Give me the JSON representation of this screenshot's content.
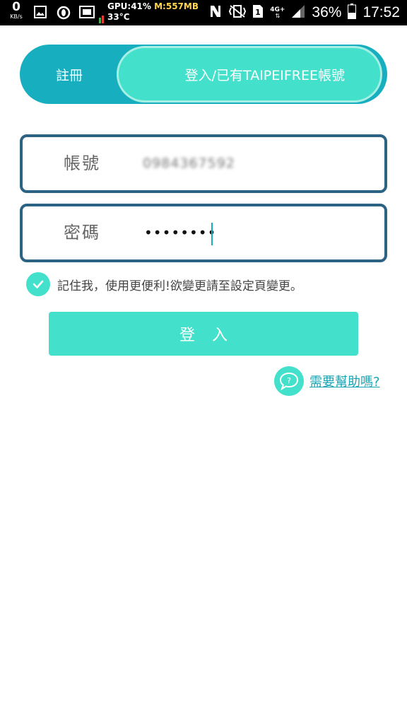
{
  "status_bar": {
    "net_speed": "0",
    "net_unit": "KB/s",
    "gpu": "GPU:41%",
    "memory": "M:557MB",
    "temperature": "33°C",
    "battery": "36%",
    "time": "17:52",
    "network_type": "4G+",
    "sim_slot": "1",
    "icons": [
      "image-icon",
      "opera-icon",
      "media-icon",
      "check-icon",
      "nfc-icon",
      "vibrate-icon",
      "sim-icon",
      "signal-icon",
      "battery-icon"
    ]
  },
  "tabs": {
    "register": "註冊",
    "login": "登入/已有TAIPEIFREE帳號",
    "active": "login"
  },
  "form": {
    "account_label": "帳號",
    "account_value": "0984367592",
    "password_label": "密碼",
    "password_mask": "••••••••"
  },
  "remember": {
    "checked": true,
    "text": "記住我，使用更便利!欲變更請至設定頁變更。"
  },
  "login_button": "登入",
  "help": {
    "icon": "chat-question-icon",
    "link": "需要幫助嗎?"
  },
  "colors": {
    "teal_dark": "#17afc0",
    "teal_light": "#43e0cb",
    "field_border": "#2c6385",
    "link": "#17a5b4"
  }
}
